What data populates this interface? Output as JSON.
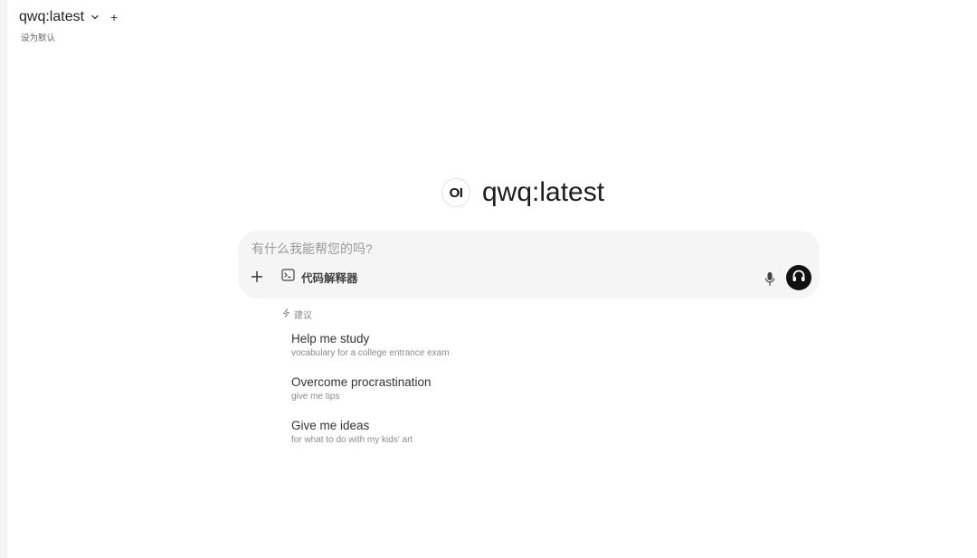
{
  "header": {
    "model_name": "qwq:latest",
    "add_symbol": "+",
    "set_default_label": "设为默认"
  },
  "hero": {
    "logo_text": "OI",
    "title": "qwq:latest"
  },
  "composer": {
    "placeholder": "有什么我能帮您的吗?",
    "code_interpreter_label": "代码解释器"
  },
  "suggestions": {
    "header": "建议",
    "items": [
      {
        "title": "Help me study",
        "subtitle": "vocabulary for a college entrance exam"
      },
      {
        "title": "Overcome procrastination",
        "subtitle": "give me tips"
      },
      {
        "title": "Give me ideas",
        "subtitle": "for what to do with my kids' art"
      }
    ]
  },
  "colors": {
    "composer_bg": "#f5f5f5",
    "voice_button_bg": "#111111",
    "muted_text": "#8a8a8a"
  },
  "icons": {
    "model_dropdown": "chevron-down-icon",
    "attach": "plus-icon",
    "code_interpreter": "terminal-icon",
    "mic": "microphone-icon",
    "voice_mode": "headphones-icon",
    "suggestion": "lightning-icon"
  }
}
